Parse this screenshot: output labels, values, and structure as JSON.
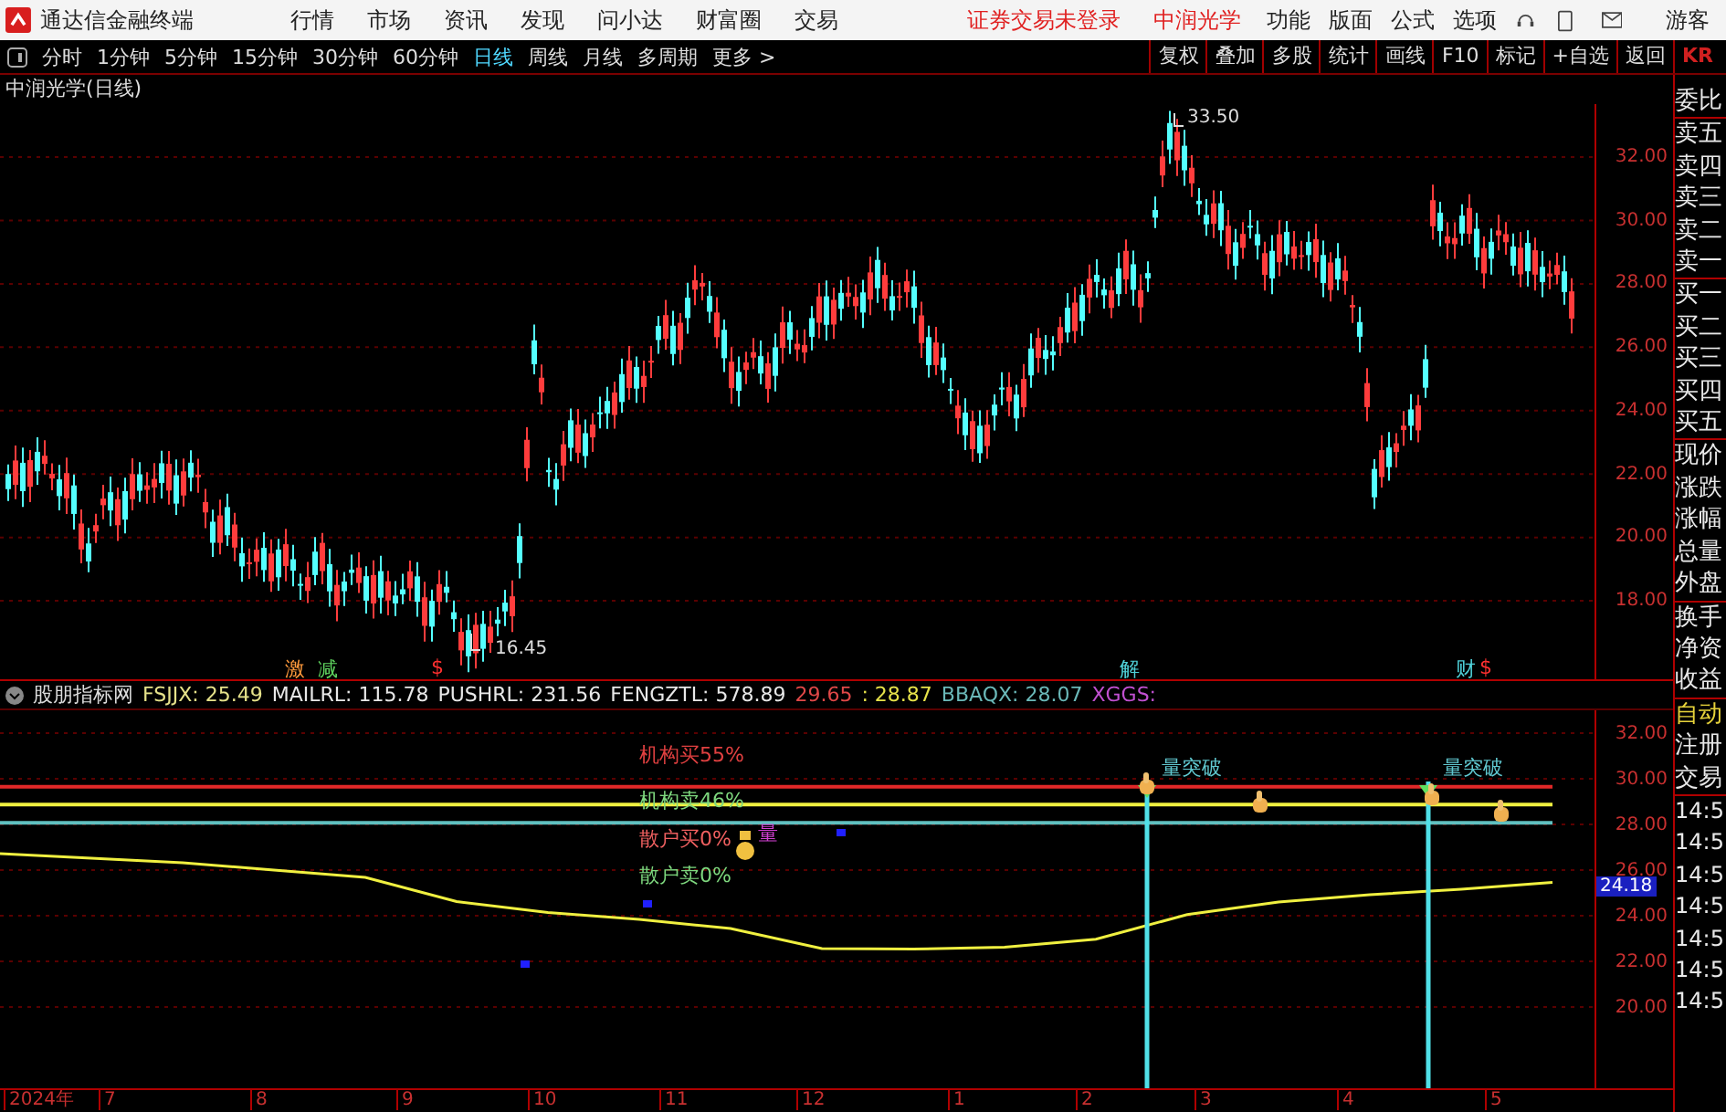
{
  "menu_bar": {
    "app_title": "通达信金融终端",
    "items": [
      "行情",
      "市场",
      "资讯",
      "发现",
      "问小达",
      "财富圈",
      "交易"
    ],
    "notice": "证券交易未登录",
    "stock": "中润光学",
    "right_items": [
      "功能",
      "版面",
      "公式",
      "选项"
    ],
    "user": "游客"
  },
  "period_bar": {
    "periods": [
      {
        "label": "分时",
        "selected": false
      },
      {
        "label": "1分钟",
        "selected": false
      },
      {
        "label": "5分钟",
        "selected": false
      },
      {
        "label": "15分钟",
        "selected": false
      },
      {
        "label": "30分钟",
        "selected": false
      },
      {
        "label": "60分钟",
        "selected": false
      },
      {
        "label": "日线",
        "selected": true
      },
      {
        "label": "周线",
        "selected": false
      },
      {
        "label": "月线",
        "selected": false
      },
      {
        "label": "多周期",
        "selected": false
      }
    ],
    "more": "更多 >",
    "tools": [
      "复权",
      "叠加",
      "多股",
      "统计",
      "画线",
      "F10",
      "标记",
      "+自选",
      "返回"
    ],
    "edge": "KR"
  },
  "chart": {
    "title": "中润光学(日线)",
    "y_ticks": [
      "32.00",
      "30.00",
      "28.00",
      "26.00",
      "24.00",
      "22.00",
      "20.00",
      "18.00"
    ],
    "peak_label": "33.50",
    "low_label": "16.45",
    "markers": [
      {
        "text": "激",
        "color": "#ff9a3c"
      },
      {
        "text": "减",
        "color": "#5fd35f"
      },
      {
        "text": "$",
        "color": "#ff3030"
      },
      {
        "text": "解",
        "color": "#4fd0d8"
      },
      {
        "text": "财",
        "color": "#4fd0d8"
      },
      {
        "text": "$",
        "color": "#ff3030"
      }
    ]
  },
  "indicator": {
    "name": "股朋指标网",
    "fields": [
      {
        "text": "FSJJX: 25.49",
        "color": "#e6e28a"
      },
      {
        "text": "MAILRL: 115.78",
        "color": "#e8e8e8"
      },
      {
        "text": "PUSHRL: 231.56",
        "color": "#e8e8e8"
      },
      {
        "text": "FENGZTL: 578.89",
        "color": "#e8e8e8"
      },
      {
        "text": "29.65",
        "color": "#e04848"
      },
      {
        "text": ": 28.87",
        "color": "#e6e24a"
      },
      {
        "text": "BBAQX: 28.07",
        "color": "#6ab8b8"
      },
      {
        "text": "XGGS:",
        "color": "#c050d0"
      }
    ],
    "levels": [
      {
        "text": "机构买55%",
        "color": "#e04040"
      },
      {
        "text": "机构卖46%",
        "color": "#7ed87e"
      },
      {
        "text": "散户买0%",
        "color": "#f06060"
      },
      {
        "text": "散户卖0%",
        "color": "#7ed87e"
      }
    ],
    "volume_tag": "量",
    "chart_data": {
      "type": "line",
      "series": [
        {
          "color": "#f0f040",
          "values": [
            26.72,
            26.52,
            26.32,
            26.0,
            25.68,
            24.62,
            24.14,
            23.84,
            23.44,
            22.56,
            22.54,
            22.62,
            22.97,
            24.05,
            24.6,
            24.92,
            25.16,
            25.46
          ]
        },
        {
          "color": "#e02828",
          "values": [
            29.65,
            29.65,
            29.65,
            29.65,
            29.65,
            29.65,
            29.65,
            29.65,
            29.65,
            29.65,
            29.65,
            29.65,
            29.65,
            29.65,
            29.65,
            29.65,
            29.65,
            29.65
          ]
        },
        {
          "color": "#f0f040",
          "values": [
            28.87,
            28.87,
            28.87,
            28.87,
            28.87,
            28.87,
            28.87,
            28.87,
            28.87,
            28.87,
            28.87,
            28.87,
            28.87,
            28.87,
            28.87,
            28.87,
            28.87,
            28.87
          ]
        },
        {
          "color": "#60c0c0",
          "values": [
            28.07,
            28.07,
            28.07,
            28.07,
            28.07,
            28.07,
            28.07,
            28.07,
            28.07,
            28.07,
            28.07,
            28.07,
            28.07,
            28.07,
            28.07,
            28.07,
            28.07,
            28.07
          ]
        }
      ],
      "ylim": [
        16.36,
        33
      ],
      "grid": true,
      "yticks": [
        {
          "value": 32,
          "label": "32.00"
        },
        {
          "value": 30,
          "label": "30.00"
        },
        {
          "value": 28,
          "label": "28.00"
        },
        {
          "value": 26,
          "label": "26.00"
        },
        {
          "value": 24,
          "label": "24.00"
        },
        {
          "value": 22,
          "label": "22.00"
        },
        {
          "value": 20,
          "label": "20.00"
        }
      ]
    },
    "breakouts": [
      "量突破",
      "量突破"
    ],
    "current_value": "24.18"
  },
  "x_axis": [
    "2024年",
    "7",
    "8",
    "9",
    "10",
    "11",
    "12",
    "1",
    "2",
    "3",
    "4",
    "5"
  ],
  "sidebar": {
    "quote_groups": [
      [
        "委比"
      ],
      [
        "卖五",
        "卖四",
        "卖三",
        "卖二",
        "卖一"
      ],
      [
        "买一",
        "买二",
        "买三",
        "买四",
        "买五"
      ],
      [
        "现价",
        "涨跌",
        "涨幅",
        "总量",
        "外盘"
      ],
      [
        "换手",
        "净资",
        "收益"
      ]
    ],
    "actions": [
      {
        "text": "自动",
        "highlighted": true
      },
      {
        "text": "注册",
        "highlighted": false
      },
      {
        "text": "交易",
        "highlighted": false
      }
    ],
    "times": [
      "14:5",
      "14:5",
      "14:5",
      "14:5",
      "14:5",
      "14:5",
      "14:5"
    ]
  }
}
